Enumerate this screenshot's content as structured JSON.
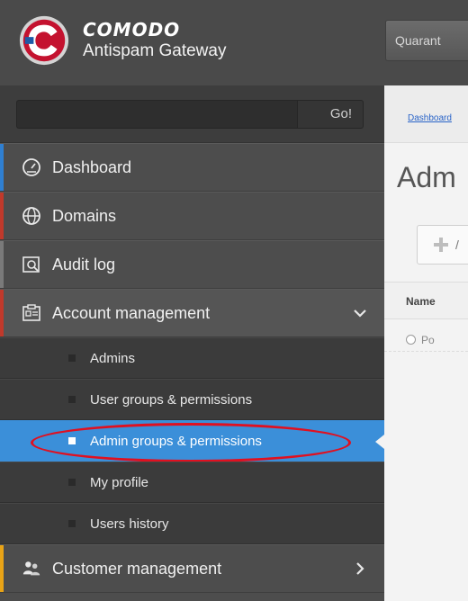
{
  "header": {
    "brand_name": "COMODO",
    "brand_product": "Antispam Gateway",
    "quarantine_button": "Quarant"
  },
  "search": {
    "placeholder": "",
    "go_label": "Go!"
  },
  "sidebar": {
    "items": [
      {
        "label": "Dashboard",
        "icon": "dashboard-gauge-icon",
        "stripe": "#2f7fd1"
      },
      {
        "label": "Domains",
        "icon": "globe-icon",
        "stripe": "#c0392b"
      },
      {
        "label": "Audit log",
        "icon": "audit-log-icon",
        "stripe": "#7a7a7a"
      },
      {
        "label": "Account management",
        "icon": "account-management-icon",
        "stripe": "#c0392b"
      }
    ],
    "account_subitems": [
      {
        "label": "Admins"
      },
      {
        "label": "User groups & permissions"
      },
      {
        "label": "Admin groups & permissions"
      },
      {
        "label": "My profile"
      },
      {
        "label": "Users history"
      }
    ],
    "customer_management": {
      "label": "Customer management",
      "icon": "customers-icon",
      "stripe": "#e8a316"
    }
  },
  "main": {
    "breadcrumb": "Dashboard",
    "page_title": "Adm",
    "add_button_label": "/",
    "table_header": "Name",
    "first_row": "Po"
  },
  "colors": {
    "active_blue": "#3b8fd9",
    "highlight_red": "#e01020",
    "header_bg": "#4a4a4a"
  }
}
